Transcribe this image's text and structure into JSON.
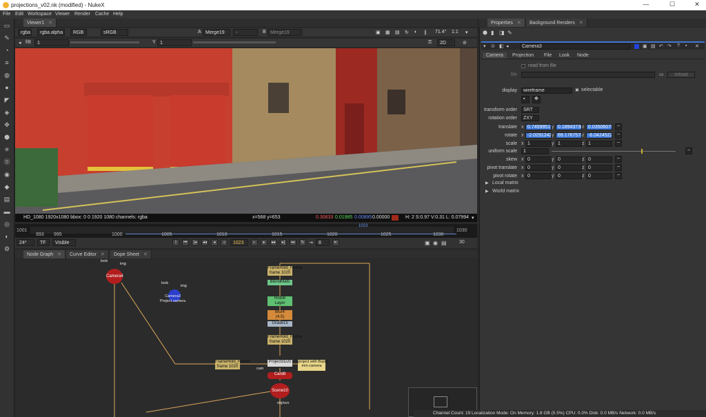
{
  "window": {
    "title": "projections_v02.nk (modified) - NukeX",
    "minimize": "—",
    "maximize": "☐",
    "close": "✕"
  },
  "menu": [
    "File",
    "Edit",
    "Workspace",
    "Viewer",
    "Render",
    "Cache",
    "Help"
  ],
  "viewer": {
    "tab": "Viewer1",
    "channels": "rgba",
    "alpha": "rgba.alpha",
    "display": "RGB",
    "colorspace": "sRGB",
    "input_a_label": "A",
    "input_a": "Merge19",
    "op": "-",
    "input_b_label": "B",
    "input_b": "Merge19",
    "zoom": "71.4°",
    "ratio": "1:1",
    "gain_label": "f/8",
    "gain": "1",
    "y_label": "Y",
    "gamma": "1",
    "mode": "2D",
    "info_format": "HD_1080 1920x1080  bbox: 0 0 1920 1080 channels: rgba",
    "info_coords": "x=568 y=653",
    "info_r": "0.30633",
    "info_g": "0.01985",
    "info_b": "0.00895",
    "info_a": "0.00000",
    "info_hsv": "H:  2 S:0.97 V:0.31  L: 0.07994",
    "swatch_color": "#a02a18"
  },
  "timeline": {
    "start": "1001",
    "end": "1030",
    "ticks": [
      "993",
      "995",
      "1000",
      "1005",
      "1010",
      "1015",
      "1020",
      "1025",
      "1030"
    ],
    "current_marker": "1023",
    "fps": "24*",
    "tf": "TF",
    "visible": "Visible",
    "frame": "1023",
    "step": "8",
    "range_end": "30",
    "i": "I"
  },
  "graph_tabs": [
    "Node Graph",
    "Curve Editor",
    "Dope Sheet"
  ],
  "nodes": [
    {
      "name": "Camera4",
      "color": "#b21e1e"
    },
    {
      "name": "Camera3\nProject camera",
      "color": "#2b3fcc"
    },
    {
      "name": "FrameHold_Frame\nframe 1020",
      "color": "#c9b26a"
    },
    {
      "name": "BlendMat5",
      "color": "#6ec58a"
    },
    {
      "name": "Roto6\nLayer",
      "color": "#5fbf72"
    },
    {
      "name": "Blur4\n(4.0)",
      "color": "#d48a3a"
    },
    {
      "name": "Grade15",
      "color": "#a7b6c7"
    },
    {
      "name": "FrameHold_Frame\nframe 1020",
      "color": "#c9b26a"
    },
    {
      "name": "FrameHold_Frame\nframe 1020",
      "color": "#c9b26a"
    },
    {
      "name": "Project3D20",
      "color": "#d8d8d8"
    },
    {
      "name": "project with Bspin\nmm camera",
      "color": "#e8d68a"
    },
    {
      "name": "Card8",
      "color": "#b21e1e"
    },
    {
      "name": "Scene10",
      "color": "#b21e1e"
    }
  ],
  "node_pins": {
    "look": "look",
    "img": "img",
    "cam": "cam",
    "obj": "obj/scn"
  },
  "props": {
    "tabs": [
      "Properties",
      "Background Renders"
    ],
    "node_name": "Camera3",
    "node_tabs": [
      "Camera",
      "Projection",
      "File",
      "Look",
      "Node"
    ],
    "read_from_file": "read from file",
    "file_label": "file",
    "reload": "reload",
    "display_label": "display",
    "display_value": "wireframe",
    "selectable": "selectable",
    "transform_order_label": "transform order",
    "transform_order": "SRT",
    "rotation_order_label": "rotation order",
    "rotation_order": "ZXY",
    "rows": [
      {
        "label": "translate",
        "x": "0.7459951",
        "y": "0.18943736",
        "z": "0.03506078",
        "selected": true
      },
      {
        "label": "rotate",
        "x": "-2.0291242",
        "y": "69.1767578",
        "z": "-6.0424522",
        "selected": true
      },
      {
        "label": "scale",
        "x": "1",
        "y": "1",
        "z": "1",
        "selected": false
      }
    ],
    "uniform_scale_label": "uniform scale",
    "uniform_scale": "1",
    "rows2": [
      {
        "label": "skew",
        "x": "0",
        "y": "0",
        "z": "0"
      },
      {
        "label": "pivot translate",
        "x": "0",
        "y": "0",
        "z": "0"
      },
      {
        "label": "pivot rotate",
        "x": "0",
        "y": "0",
        "z": "0"
      }
    ],
    "local_matrix": "Local matrix",
    "world_matrix": "World matrix"
  },
  "status": "Channel Count: 19  Localization Mode: On  Memory: 1.8 GB (5.5%)  CPU: 0.0%  Disk: 0.0 MB/s  Network: 0.0 MB/s",
  "colors": {
    "accent": "#3d78d6",
    "panel": "#353535",
    "selection": "#3d78d6"
  }
}
